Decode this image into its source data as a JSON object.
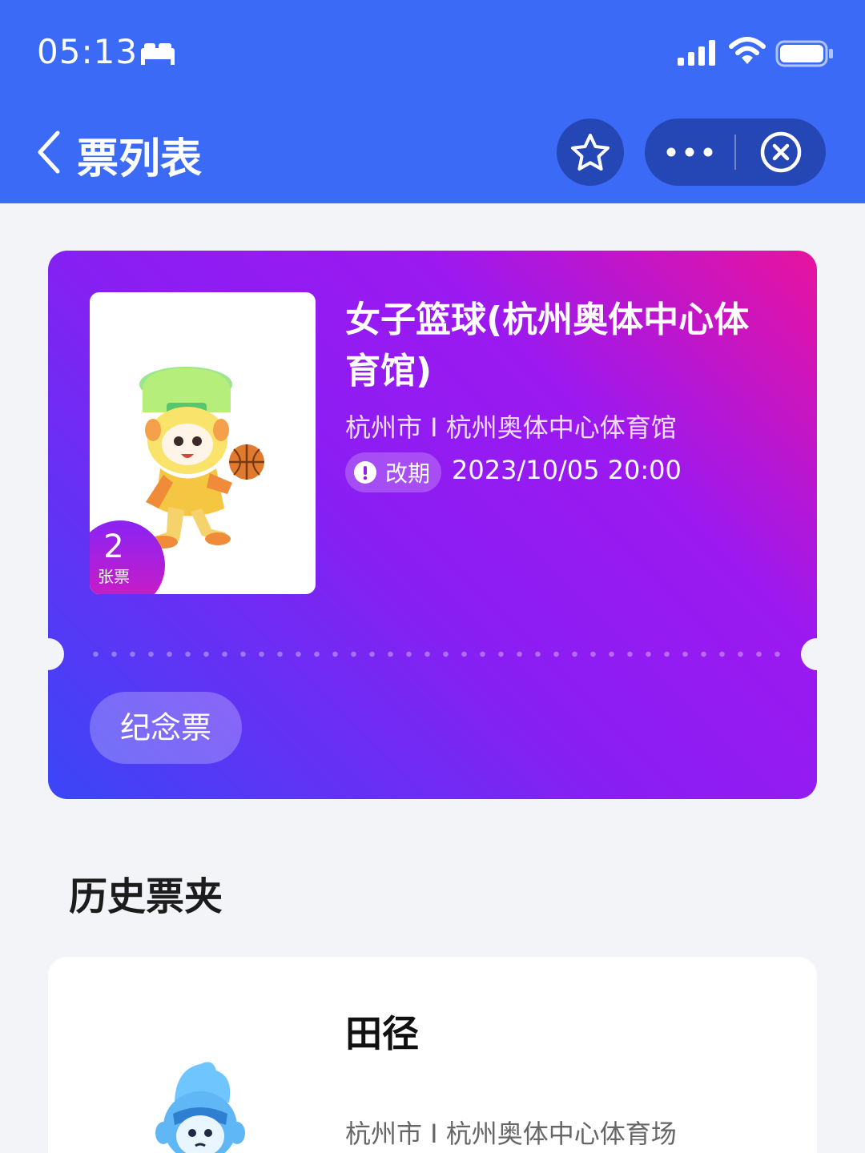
{
  "status_bar": {
    "time": "05:13",
    "icons": [
      "sleep-icon",
      "signal-icon",
      "wifi-icon",
      "battery-icon"
    ]
  },
  "nav": {
    "title": "票列表",
    "back_icon": "chevron-left-icon",
    "favorite_icon": "star-icon",
    "more_icon": "more-dots-icon",
    "close_icon": "close-circle-icon"
  },
  "current_ticket": {
    "count": "2",
    "count_unit": "张票",
    "title": "女子篮球(杭州奥体中心体育馆)",
    "venue": "杭州市 I 杭州奥体中心体育馆",
    "status_badge": "改期",
    "datetime": "2023/10/05 20:00",
    "souvenir_label": "纪念票"
  },
  "history": {
    "section_title": "历史票夹",
    "items": [
      {
        "title": "田径",
        "venue": "杭州市 I 杭州奥体中心体育场"
      }
    ]
  },
  "colors": {
    "header_bg": "#3b6bf6",
    "capsule_bg": "#2546b5",
    "card_gradient_start": "#e8139e",
    "card_gradient_mid": "#8a1ef2",
    "card_gradient_end": "#3a46f7",
    "page_bg": "#f3f4f8"
  }
}
